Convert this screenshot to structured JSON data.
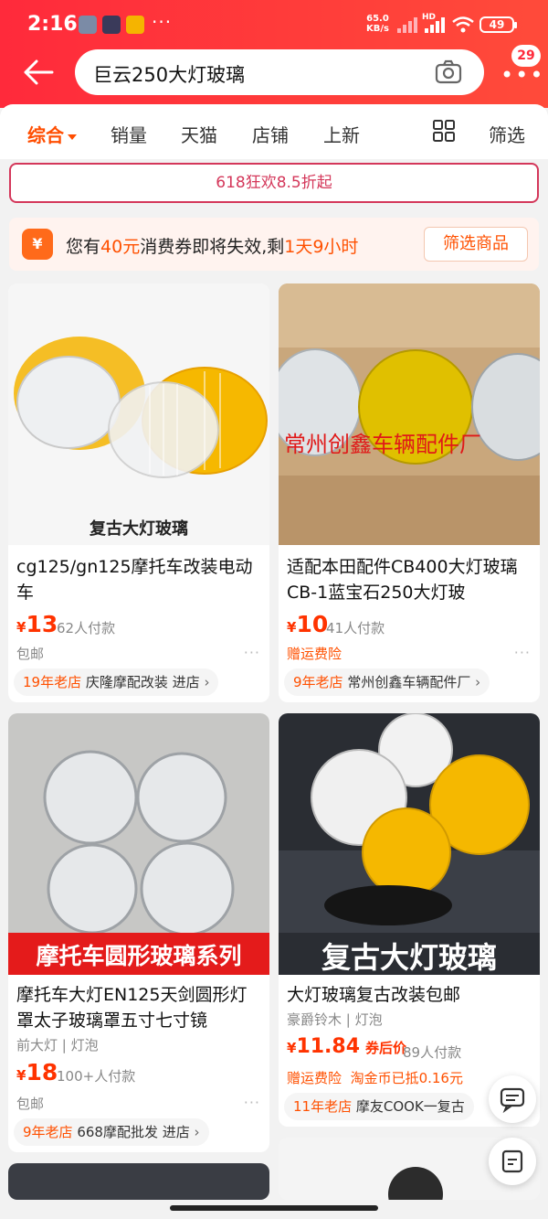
{
  "status_bar": {
    "time": "2:16",
    "net_speed": "65.0",
    "net_unit": "KB/s",
    "battery": "49",
    "hd": "HD"
  },
  "header": {
    "search_text": "巨云250大灯玻璃",
    "cart_badge": "29"
  },
  "sort_tabs": [
    "综合",
    "销量",
    "天猫",
    "店铺",
    "上新"
  ],
  "filter_label": "筛选",
  "promo_banner": "618狂欢8.5折起",
  "coupon_notice": {
    "icon_text": "¥",
    "prefix": "您有",
    "amount": "40元",
    "middle": "消费券即将失效,剩",
    "remaining": "1天9小时",
    "button": "筛选商品"
  },
  "products": [
    {
      "image_caption": "复古大灯玻璃",
      "title": "cg125/gn125摩托车改装电动车",
      "yen": "¥",
      "price": "13",
      "buyers": "62人付款",
      "service": "包邮",
      "shop_age": "19年老店",
      "shop_name": "庆隆摩配改装",
      "enter": "进店"
    },
    {
      "image_caption": "常州创鑫车辆配件厂",
      "title": "适配本田配件CB400大灯玻璃  CB-1蓝宝石250大灯玻",
      "yen": "¥",
      "price": "10",
      "buyers": "41人付款",
      "service": "赠运费险",
      "shop_age": "9年老店",
      "shop_name": "常州创鑫车辆配件厂"
    },
    {
      "image_caption": "摩托车圆形玻璃系列",
      "title": "摩托车大灯EN125天剑圆形灯罩太子玻璃罩五寸七寸镜",
      "subtitle": "前大灯 | 灯泡",
      "yen": "¥",
      "price": "18",
      "buyers": "100+人付款",
      "service": "包邮",
      "shop_age": "9年老店",
      "shop_name": "668摩配批发",
      "enter": "进店"
    },
    {
      "image_caption": "复古大灯玻璃",
      "title": "大灯玻璃复古改装包邮",
      "subtitle": "豪爵铃木 | 灯泡",
      "yen": "¥",
      "price": "11.84",
      "coupon_price": "券后价",
      "buyers": "89人付款",
      "service": "赠运费险",
      "service_extra": "淘金币已抵0.16元",
      "shop_age": "11年老店",
      "shop_name": "摩友COOK一复古"
    }
  ],
  "colors": {
    "header_red": "#ff2a3b",
    "accent_orange": "#ff5000",
    "price_red": "#ff3300",
    "promo_pink": "#d4375a"
  }
}
